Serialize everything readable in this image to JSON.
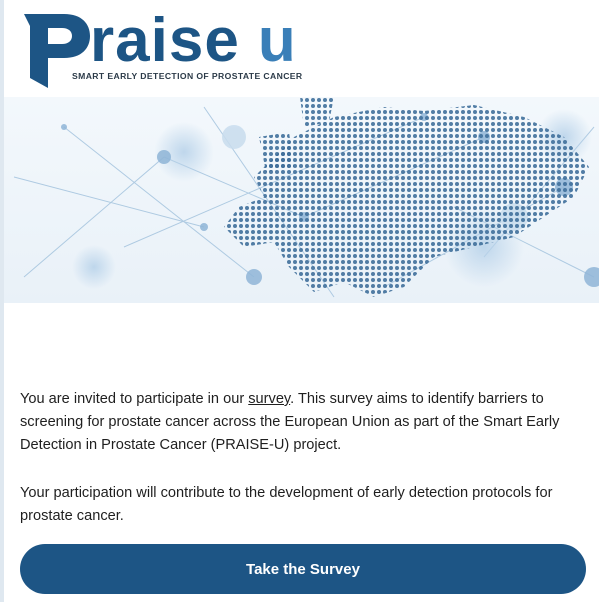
{
  "logo": {
    "brand_main": "raise",
    "brand_accent": "u",
    "tagline": "SMART EARLY DETECTION OF PROSTATE CANCER",
    "colors": {
      "primary": "#1d5585",
      "accent": "#3a7fb8"
    }
  },
  "banner": {
    "icon": "europe-network-map-icon"
  },
  "body": {
    "para1_before": "You are invited to participate in our ",
    "para1_link": "survey",
    "para1_after": ". This survey aims to identify barriers to screening for prostate cancer across the European Union as part of the Smart Early Detection in Prostate Cancer (PRAISE-U) project.",
    "para2": "Your participation will contribute to the development of early detection protocols for prostate cancer."
  },
  "cta": {
    "label": "Take the Survey",
    "color": "#1d5585"
  }
}
